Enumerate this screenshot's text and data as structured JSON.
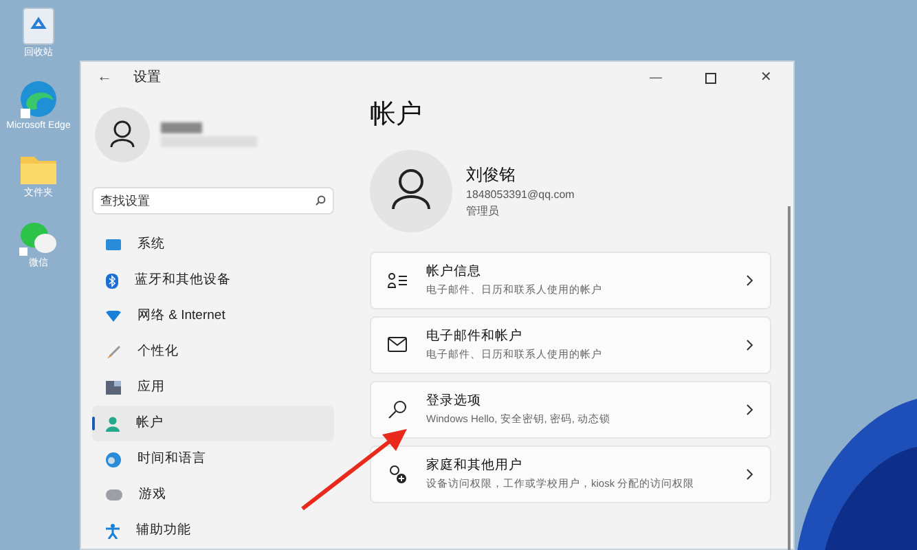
{
  "desktop_icons": [
    {
      "label": "回收站"
    },
    {
      "label": "Microsoft Edge"
    },
    {
      "label": "文件夹"
    },
    {
      "label": "微信"
    }
  ],
  "window": {
    "title": "设置",
    "back": "←",
    "minimize": "—",
    "close": "✕"
  },
  "search": {
    "placeholder": "查找设置"
  },
  "sidebar": {
    "items": [
      {
        "label": "系统",
        "selected": false
      },
      {
        "label": "蓝牙和其他设备",
        "selected": false
      },
      {
        "label": "网络 & Internet",
        "selected": false
      },
      {
        "label": "个性化",
        "selected": false
      },
      {
        "label": "应用",
        "selected": false
      },
      {
        "label": "帐户",
        "selected": true
      },
      {
        "label": "时间和语言",
        "selected": false
      },
      {
        "label": "游戏",
        "selected": false
      },
      {
        "label": "辅助功能",
        "selected": false
      }
    ]
  },
  "page": {
    "title": "帐户",
    "user": {
      "name": "刘俊铭",
      "email": "1848053391@qq.com",
      "role": "管理员"
    },
    "cards": [
      {
        "title": "帐户信息",
        "subtitle": "电子邮件、日历和联系人使用的帐户"
      },
      {
        "title": "电子邮件和帐户",
        "subtitle": "电子邮件、日历和联系人使用的帐户"
      },
      {
        "title": "登录选项",
        "subtitle": "Windows Hello, 安全密钥, 密码, 动态锁"
      },
      {
        "title": "家庭和其他用户",
        "subtitle": "设备访问权限，工作或学校用户，kiosk 分配的访问权限"
      }
    ]
  }
}
